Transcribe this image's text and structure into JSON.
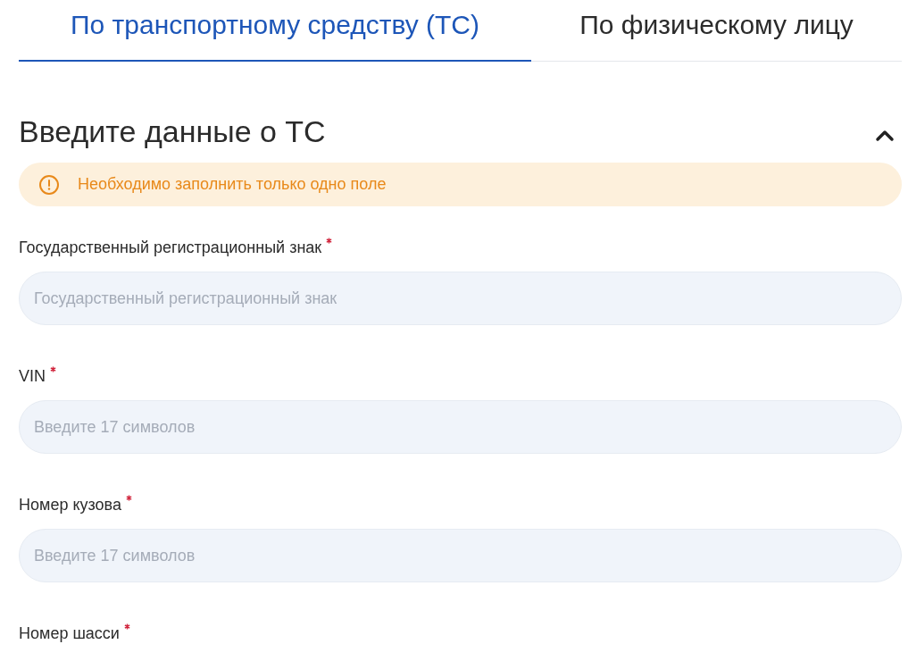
{
  "tabs": [
    {
      "label": "По транспортному средству (ТС)",
      "selected": true
    },
    {
      "label": "По физическому лицу",
      "selected": false
    }
  ],
  "section": {
    "title": "Введите данные о ТС",
    "expanded": true
  },
  "alert": {
    "text": "Необходимо заполнить только одно поле"
  },
  "fields": [
    {
      "label": "Государственный регистрационный знак",
      "required": true,
      "placeholder": "Государственный регистрационный знак"
    },
    {
      "label": "VIN",
      "required": true,
      "placeholder": "Введите 17 символов"
    },
    {
      "label": "Номер кузова",
      "required": true,
      "placeholder": "Введите 17 символов"
    },
    {
      "label": "Номер шасси",
      "required": true
    }
  ]
}
